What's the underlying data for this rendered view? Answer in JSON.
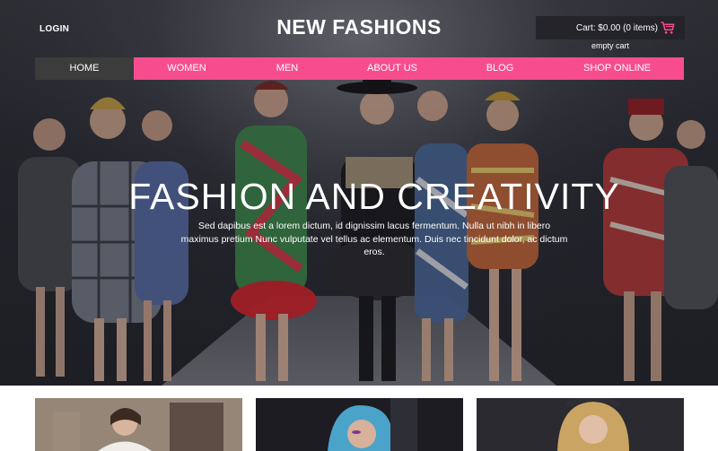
{
  "header": {
    "login_label": "LOGIN",
    "site_title": "NEW FASHIONS",
    "cart_text": "Cart: $0.00 (0 items)",
    "empty_cart_label": "empty cart"
  },
  "nav": {
    "items": [
      {
        "label": "HOME"
      },
      {
        "label": "WOMEN"
      },
      {
        "label": "MEN"
      },
      {
        "label": "ABOUT US"
      },
      {
        "label": "BLOG"
      },
      {
        "label": "SHOP ONLINE"
      }
    ]
  },
  "hero": {
    "heading": "FASHION AND CREATIVITY",
    "subtext": "Sed dapibus est a lorem dictum, id dignissim lacus fermentum. Nulla ut nibh in libero maximus pretium Nunc vulputate vel tellus ac elementum. Duis nec tincidunt dolor, ac dictum eros."
  },
  "colors": {
    "accent": "#f74d8e",
    "nav_active": "#3c3c3c",
    "cart_bg": "#232328"
  },
  "icons": {
    "cart": "shopping-cart-icon"
  }
}
